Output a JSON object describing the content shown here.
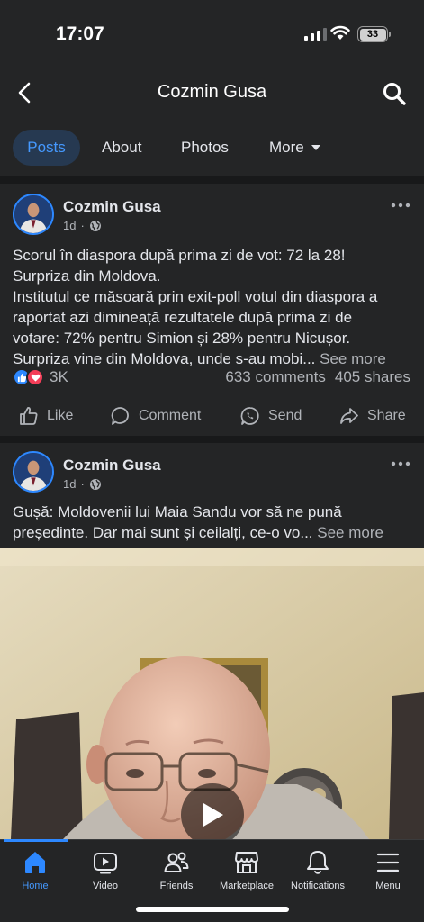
{
  "status_bar": {
    "time": "17:07",
    "battery": "33"
  },
  "header": {
    "title": "Cozmin Gusa"
  },
  "tabs": [
    {
      "label": "Posts"
    },
    {
      "label": "About"
    },
    {
      "label": "Photos"
    },
    {
      "label": "More"
    }
  ],
  "posts": [
    {
      "author": "Cozmin Gusa",
      "time": "1d",
      "text_lines": [
        "Scorul în diaspora după prima zi de vot: 72 la 28!",
        "Surpriza din Moldova.",
        "Institutul ce măsoară prin exit-poll votul din diaspora a",
        "raportat azi dimineață rezultatele după prima zi de",
        "votare: 72% pentru Simion și 28% pentru Nicușor.",
        "Surpriza vine din Moldova, unde s-au mobi..."
      ],
      "see_more": "See more",
      "reaction_count": "3K",
      "comments": "633 comments",
      "shares": "405 shares",
      "actions": {
        "like": "Like",
        "comment": "Comment",
        "send": "Send",
        "share": "Share"
      }
    },
    {
      "author": "Cozmin Gusa",
      "time": "1d",
      "text_lines": [
        "Gușă: Moldovenii lui Maia Sandu vor să ne pună",
        "președinte. Dar mai sunt și ceilalți, ce-o vo..."
      ],
      "see_more": "See more"
    }
  ],
  "bottom_nav": [
    {
      "label": "Home",
      "icon": "home-icon",
      "active": true
    },
    {
      "label": "Video",
      "icon": "video-icon"
    },
    {
      "label": "Friends",
      "icon": "friends-icon"
    },
    {
      "label": "Marketplace",
      "icon": "marketplace-icon"
    },
    {
      "label": "Notifications",
      "icon": "bell-icon"
    },
    {
      "label": "Menu",
      "icon": "menu-icon"
    }
  ],
  "colors": {
    "accent": "#2d88ff",
    "background": "#242526",
    "love": "#f33e58"
  }
}
